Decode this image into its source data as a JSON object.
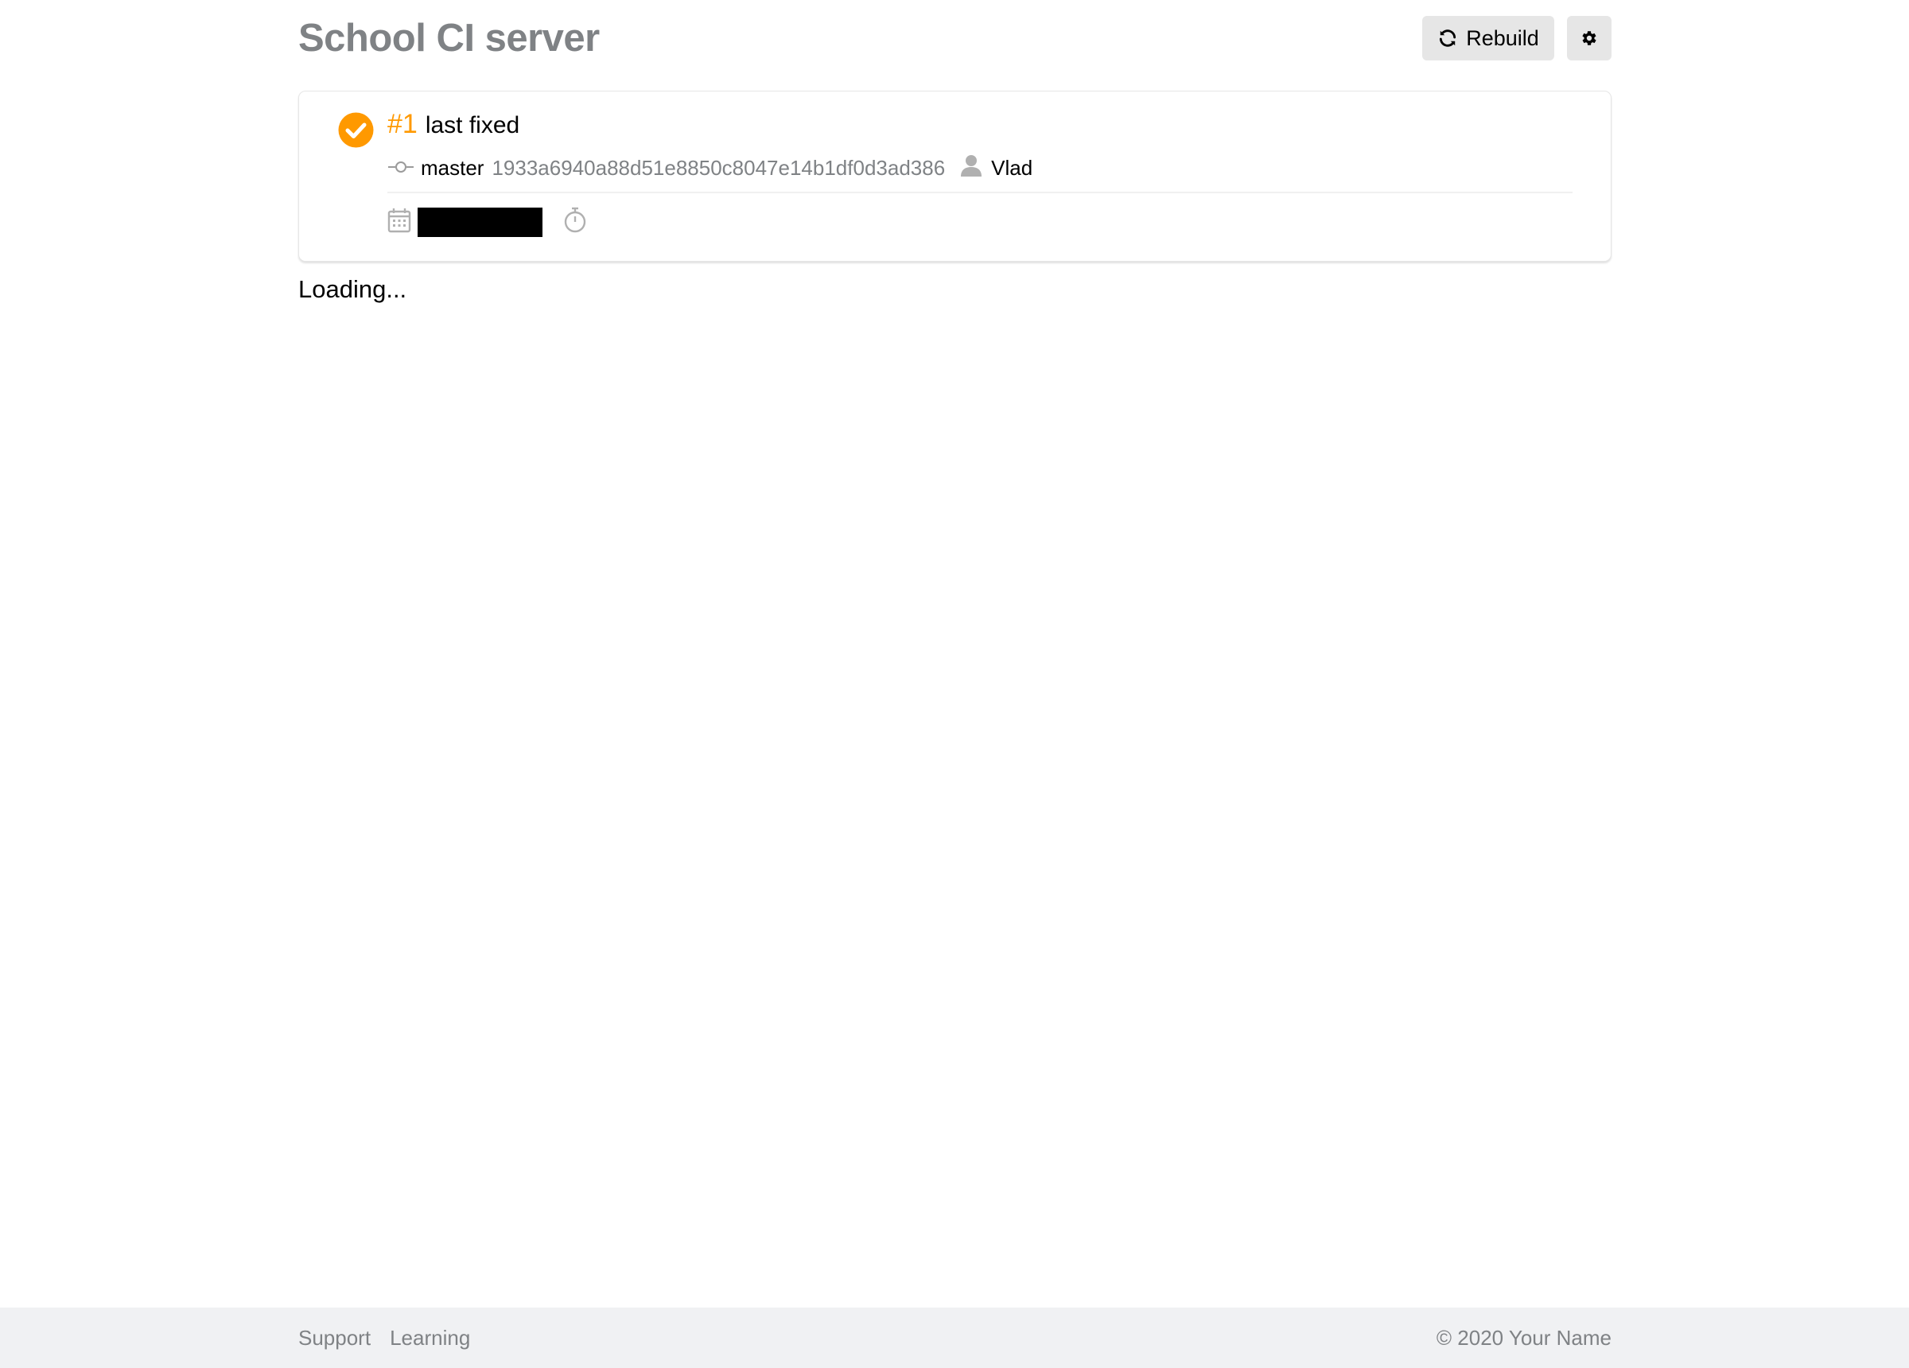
{
  "header": {
    "title": "School CI server",
    "rebuild_label": "Rebuild",
    "rebuild_icon": "refresh-icon",
    "settings_icon": "gear-icon"
  },
  "build": {
    "status": "success",
    "status_color": "#ff9900",
    "number": "#1",
    "message": "last fixed",
    "branch": "master",
    "commit_hash": "1933a6940a88d51e8850c8047e14b1df0d3ad386",
    "author": "Vlad",
    "icons": {
      "status": "check-circle-icon",
      "branch": "commit-branch-icon",
      "author": "user-icon",
      "date": "calendar-icon",
      "duration": "stopwatch-icon"
    }
  },
  "main": {
    "loading_text": "Loading..."
  },
  "footer": {
    "links": [
      {
        "label": "Support"
      },
      {
        "label": "Learning"
      }
    ],
    "copyright": "© 2020 Your Name"
  },
  "colors": {
    "accent": "#ff9900",
    "muted_text": "#7f8285",
    "button_bg": "#e6e6e6",
    "footer_bg": "#f0f1f3"
  }
}
